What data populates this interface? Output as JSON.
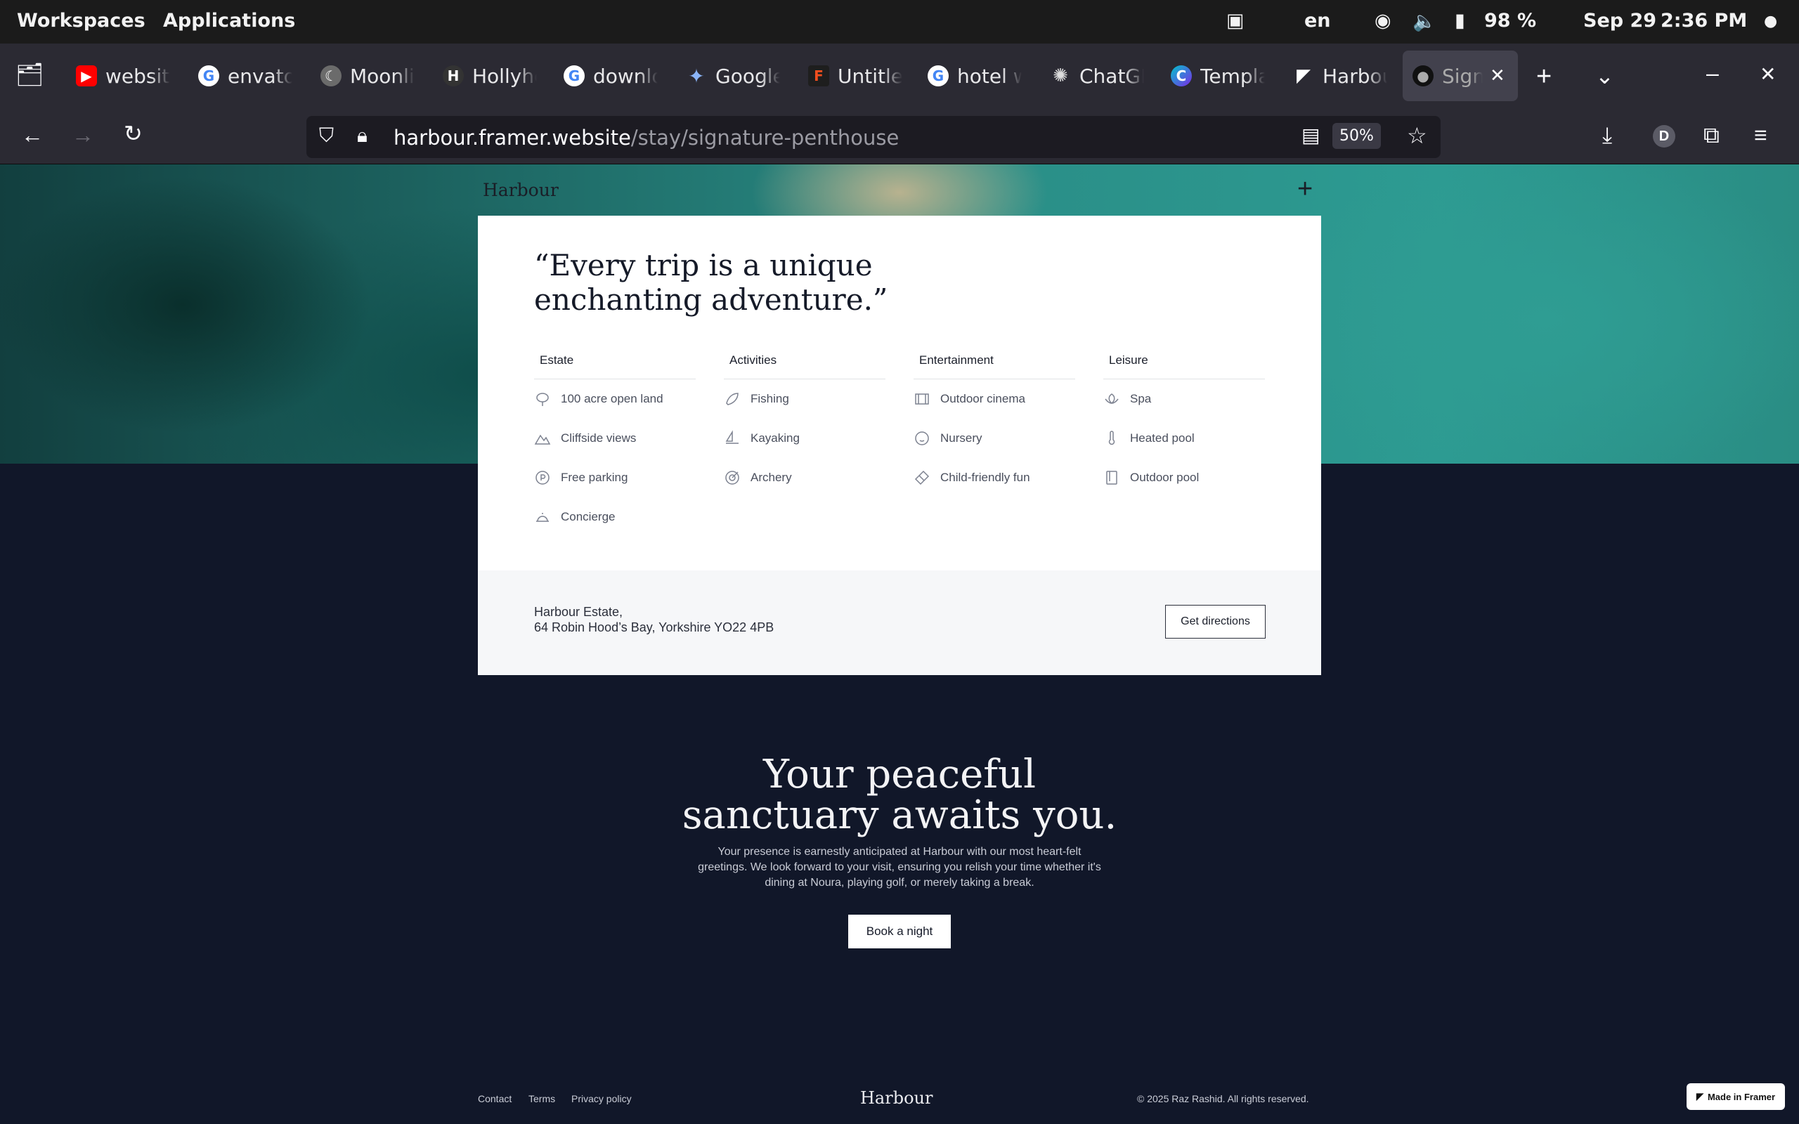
{
  "system": {
    "workspaces": "Workspaces",
    "applications": "Applications",
    "lang": "en",
    "battery": "98 %",
    "date": "Sep 29",
    "time": "2:36 PM"
  },
  "tabs": [
    {
      "label": "website",
      "icon": "youtube-icon",
      "color": "#ff0000"
    },
    {
      "label": "envato",
      "icon": "google-icon",
      "color": "#4285f4"
    },
    {
      "label": "Moonlit",
      "icon": "moonlit-icon",
      "color": "#777777"
    },
    {
      "label": "Hollyhc",
      "icon": "hollyhock-icon",
      "color": "#333333"
    },
    {
      "label": "downlo",
      "icon": "google-icon",
      "color": "#4285f4"
    },
    {
      "label": "Google",
      "icon": "gemini-icon",
      "color": "#7b61ff"
    },
    {
      "label": "Untitle",
      "icon": "figma-icon",
      "color": "#f24e1e"
    },
    {
      "label": "hotel w",
      "icon": "google-icon",
      "color": "#4285f4"
    },
    {
      "label": "ChatGP",
      "icon": "chatgpt-icon",
      "color": "#444444"
    },
    {
      "label": "Templa",
      "icon": "canva-icon",
      "color": "#7d2ae8"
    },
    {
      "label": "Harbou",
      "icon": "framer-icon",
      "color": "#111111"
    },
    {
      "label": "Signa",
      "icon": "harbour-icon",
      "color": "#333333"
    }
  ],
  "nav": {
    "url_host": "harbour.framer.website",
    "url_path": "/stay/signature-penthouse",
    "zoom": "50%",
    "avatar": "D"
  },
  "site": {
    "brand": "Harbour",
    "quote": "“Every trip is a unique enchanting adventure.”",
    "columns": [
      {
        "title": "Estate",
        "items": [
          {
            "label": "100 acre open land",
            "icon": "tree-icon"
          },
          {
            "label": "Cliffside views",
            "icon": "mountain-icon"
          },
          {
            "label": "Free parking",
            "icon": "parking-icon"
          },
          {
            "label": "Concierge",
            "icon": "bell-icon"
          }
        ]
      },
      {
        "title": "Activities",
        "items": [
          {
            "label": "Fishing",
            "icon": "fish-icon"
          },
          {
            "label": "Kayaking",
            "icon": "sailboat-icon"
          },
          {
            "label": "Archery",
            "icon": "target-icon"
          }
        ]
      },
      {
        "title": "Entertainment",
        "items": [
          {
            "label": "Outdoor cinema",
            "icon": "film-icon"
          },
          {
            "label": "Nursery",
            "icon": "baby-icon"
          },
          {
            "label": "Child-friendly fun",
            "icon": "ticket-icon"
          }
        ]
      },
      {
        "title": "Leisure",
        "items": [
          {
            "label": "Spa",
            "icon": "lotus-icon"
          },
          {
            "label": "Heated pool",
            "icon": "thermometer-icon"
          },
          {
            "label": "Outdoor pool",
            "icon": "pool-icon"
          }
        ]
      }
    ],
    "address_line1": "Harbour Estate,",
    "address_line2": "64 Robin Hood’s Bay, Yorkshire YO22 4PB",
    "directions": "Get directions",
    "headline_line1": "Your peaceful",
    "headline_line2": "sanctuary awaits you.",
    "paragraph": "Your presence is earnestly anticipated at Harbour with our most heart-felt greetings. We look forward to your visit, ensuring you relish your time whether it's dining at Noura, playing golf, or merely taking a break.",
    "book": "Book a night",
    "footer": {
      "contact": "Contact",
      "terms": "Terms",
      "privacy": "Privacy policy",
      "copyright": "© 2025 Raz Rashid. All rights reserved.",
      "framer_badge": "Made in Framer"
    }
  }
}
